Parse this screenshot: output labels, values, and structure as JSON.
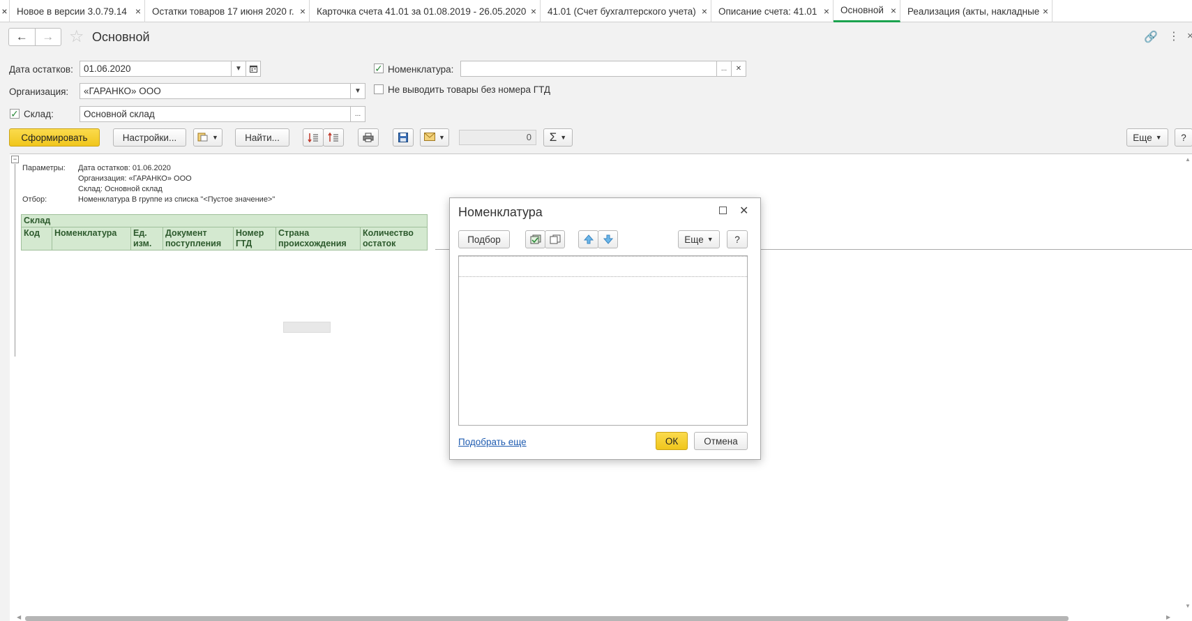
{
  "tabs": [
    {
      "label": "Новое в версии 3.0.79.14",
      "active": false
    },
    {
      "label": "Остатки товаров 17 июня 2020 г.",
      "active": false
    },
    {
      "label": "Карточка счета 41.01 за 01.08.2019 - 26.05.2020",
      "active": false
    },
    {
      "label": "41.01 (Счет бухгалтерского учета)",
      "active": false
    },
    {
      "label": "Описание счета: 41.01",
      "active": false
    },
    {
      "label": "Основной",
      "active": true
    },
    {
      "label": "Реализация (акты, накладные)",
      "active": false
    }
  ],
  "tab_close_glyph": "×",
  "page": {
    "title": "Основной"
  },
  "form": {
    "date_label": "Дата остатков:",
    "date_value": "01.06.2020",
    "org_label": "Организация:",
    "org_value": "«ГАРАНКО» ООО",
    "warehouse_label": "Склад:",
    "warehouse_value": "Основной склад",
    "warehouse_checked": true,
    "nomenclature_label": "Номенклатура:",
    "nomenclature_value": "",
    "nomenclature_checked": true,
    "no_gtd_label": "Не выводить товары без номера ГТД",
    "no_gtd_checked": false
  },
  "toolbar": {
    "generate_label": "Сформировать",
    "settings_label": "Настройки...",
    "find_label": "Найти...",
    "sum_value": "0",
    "more_label": "Еще",
    "help_label": "?"
  },
  "report": {
    "params_label": "Параметры:",
    "params": [
      "Дата остатков: 01.06.2020",
      "Организация: «ГАРАНКО» ООО",
      "Склад: Основной склад"
    ],
    "filter_label": "Отбор:",
    "filter_value": "Номенклатура В группе из списка \"<Пустое значение>\"",
    "group_header": "Склад",
    "columns": [
      {
        "l1": "Код",
        "l2": ""
      },
      {
        "l1": "Номенклатура",
        "l2": ""
      },
      {
        "l1": "Ед.",
        "l2": "изм."
      },
      {
        "l1": "Документ",
        "l2": "поступления"
      },
      {
        "l1": "Номер",
        "l2": "ГТД"
      },
      {
        "l1": "Страна",
        "l2": "происхождения"
      },
      {
        "l1": "Количество",
        "l2": "остаток"
      }
    ]
  },
  "dialog": {
    "title": "Номенклатура",
    "pick_label": "Подбор",
    "more_label": "Еще",
    "help_label": "?",
    "pick_more_link": "Подобрать еще",
    "ok_label": "ОК",
    "cancel_label": "Отмена"
  },
  "colors": {
    "accent_yellow": "#f5d02a",
    "active_tab_underline": "#1ba34e",
    "report_header_bg": "#d4e9d0",
    "link": "#1e5bb0"
  }
}
